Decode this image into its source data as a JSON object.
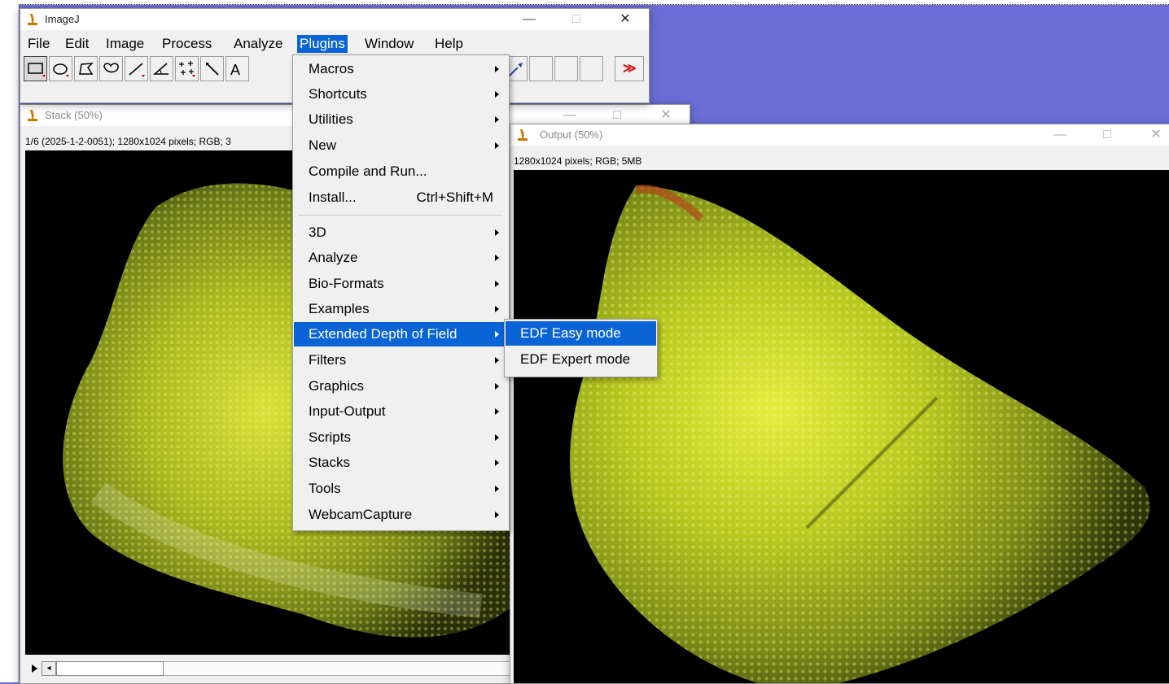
{
  "imagej_window": {
    "title": "ImageJ",
    "controls": {
      "minimize": "—",
      "maximize": "□",
      "close": "✕"
    },
    "menus": [
      "File",
      "Edit",
      "Image",
      "Process",
      "Analyze",
      "Plugins",
      "Window",
      "Help"
    ],
    "active_menu": "Plugins",
    "tools": [
      "rectangle-tool",
      "oval-tool",
      "polygon-tool",
      "freehand-tool",
      "line-tool",
      "angle-tool",
      "point-tool",
      "wand-tool",
      "text-tool",
      "dropper-tool",
      "custom-tool-1",
      "custom-tool-2",
      "custom-tool-3",
      "more-tools"
    ],
    "more_tools_glyph": "≫"
  },
  "stack_window": {
    "title": "Stack (50%)",
    "status": "1/6 (2025-1-2-0051); 1280x1024 pixels; RGB; 3",
    "controls": {
      "minimize": "—",
      "maximize": "□",
      "close": "✕"
    }
  },
  "output_window": {
    "title": "Output (50%)",
    "status": "1280x1024 pixels; RGB; 5MB",
    "controls": {
      "minimize": "—",
      "maximize": "□",
      "close": "✕"
    }
  },
  "plugins_menu": {
    "items": [
      {
        "label": "Macros",
        "submenu": true
      },
      {
        "label": "Shortcuts",
        "submenu": true
      },
      {
        "label": "Utilities",
        "submenu": true
      },
      {
        "label": "New",
        "submenu": true
      },
      {
        "label": "Compile and Run...",
        "submenu": false
      },
      {
        "label": "Install...",
        "shortcut": "Ctrl+Shift+M",
        "submenu": false
      },
      {
        "label": "3D",
        "submenu": true
      },
      {
        "label": "Analyze",
        "submenu": true
      },
      {
        "label": "Bio-Formats",
        "submenu": true
      },
      {
        "label": "Examples",
        "submenu": true
      },
      {
        "label": "Extended Depth of Field",
        "submenu": true,
        "highlighted": true
      },
      {
        "label": "Filters",
        "submenu": true
      },
      {
        "label": "Graphics",
        "submenu": true
      },
      {
        "label": "Input-Output",
        "submenu": true
      },
      {
        "label": "Scripts",
        "submenu": true
      },
      {
        "label": "Stacks",
        "submenu": true
      },
      {
        "label": "Tools",
        "submenu": true
      },
      {
        "label": "WebcamCapture",
        "submenu": true
      }
    ]
  },
  "edf_submenu": {
    "items": [
      {
        "label": "EDF Easy mode",
        "highlighted": true
      },
      {
        "label": "EDF Expert mode",
        "highlighted": false
      }
    ]
  },
  "colors": {
    "desktop": "#6a6fd8",
    "menu_highlight": "#0a64d6",
    "specimen_yellow": "#c8d820"
  }
}
